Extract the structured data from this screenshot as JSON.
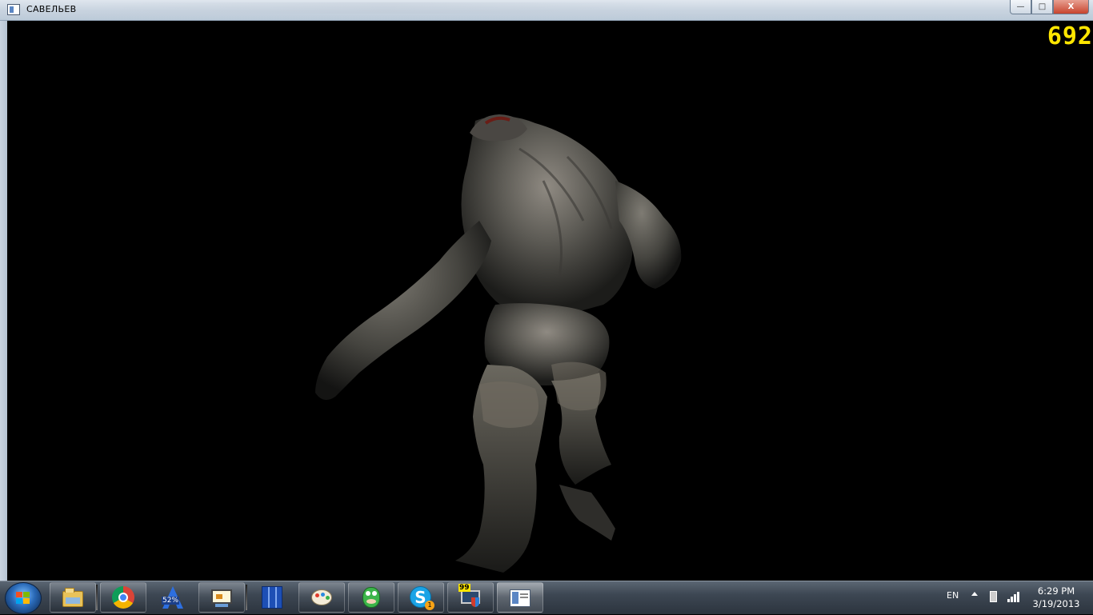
{
  "window": {
    "title": "САВЕЛЬЕВ",
    "buttons": {
      "minimize": "—",
      "maximize": "□",
      "close": "X"
    }
  },
  "viewport": {
    "fps_counter": "692",
    "scene": "3d-creature-model"
  },
  "taskbar": {
    "start_button": "start-orb-icon",
    "pinned": [
      {
        "name": "windows-explorer-icon",
        "active": false
      },
      {
        "name": "chrome-icon",
        "active": false
      },
      {
        "name": "avast-icon",
        "label": "52%",
        "active": false
      },
      {
        "name": "snipping-tool-icon",
        "active": false
      },
      {
        "name": "archive-manager-icon",
        "active": false
      },
      {
        "name": "paint-icon",
        "active": false
      },
      {
        "name": "bubble-dragon-icon",
        "active": false
      },
      {
        "name": "skype-icon",
        "badge": "1",
        "active": false
      },
      {
        "name": "monitor-shield-icon",
        "label": "99",
        "active": false
      },
      {
        "name": "active-window-icon",
        "active": true
      }
    ],
    "tray": {
      "language": "EN",
      "time": "6:29 PM",
      "date": "3/19/2013"
    }
  },
  "colors": {
    "fps": "#ffe600",
    "viewport_bg": "#000000",
    "titlebar": "#c9d4e0"
  }
}
